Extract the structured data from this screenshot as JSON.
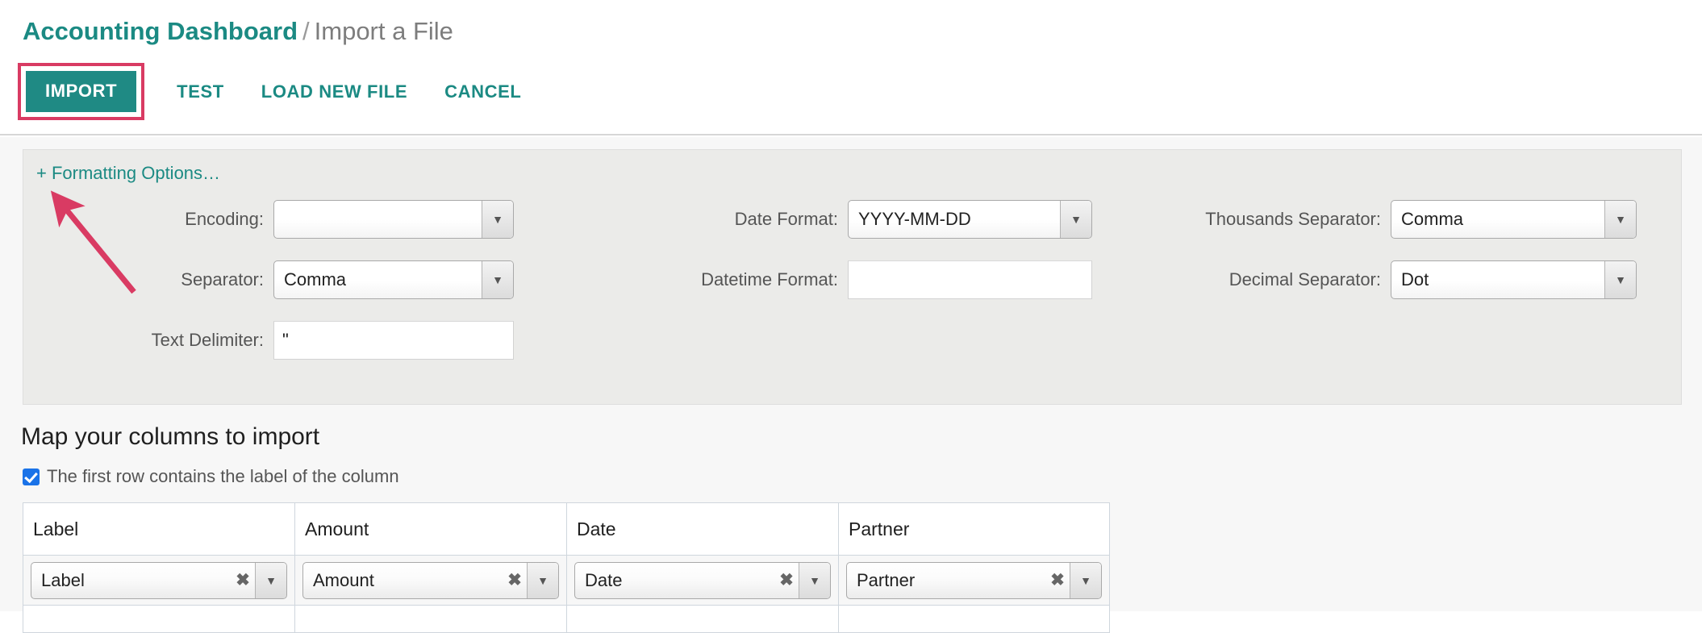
{
  "breadcrumb": {
    "parent": "Accounting Dashboard",
    "separator": "/",
    "current": "Import a File"
  },
  "toolbar": {
    "import_label": "IMPORT",
    "test_label": "TEST",
    "load_new_file_label": "LOAD NEW FILE",
    "cancel_label": "CANCEL"
  },
  "formatting": {
    "toggle_label": "+ Formatting Options…",
    "fields": {
      "encoding": {
        "label": "Encoding:",
        "value": ""
      },
      "separator": {
        "label": "Separator:",
        "value": "Comma"
      },
      "text_delimiter": {
        "label": "Text Delimiter:",
        "value": "\""
      },
      "date_format": {
        "label": "Date Format:",
        "value": "YYYY-MM-DD"
      },
      "datetime_format": {
        "label": "Datetime Format:",
        "value": ""
      },
      "thousands_separator": {
        "label": "Thousands Separator:",
        "value": "Comma"
      },
      "decimal_separator": {
        "label": "Decimal Separator:",
        "value": "Dot"
      }
    }
  },
  "mapping": {
    "title": "Map your columns to import",
    "first_row_checkbox_label": "The first row contains the label of the column",
    "first_row_checked": true,
    "headers": [
      "Label",
      "Amount",
      "Date",
      "Partner"
    ],
    "selected": [
      "Label",
      "Amount",
      "Date",
      "Partner"
    ]
  },
  "icons": {
    "dropdown_arrow": "▼",
    "clear": "✖"
  },
  "colors": {
    "accent_teal": "#1f8a84",
    "annotation_pink": "#d93b63",
    "panel_bg": "#ebebe9",
    "page_bg": "#f7f7f7",
    "checkbox_blue": "#1a73e8"
  }
}
